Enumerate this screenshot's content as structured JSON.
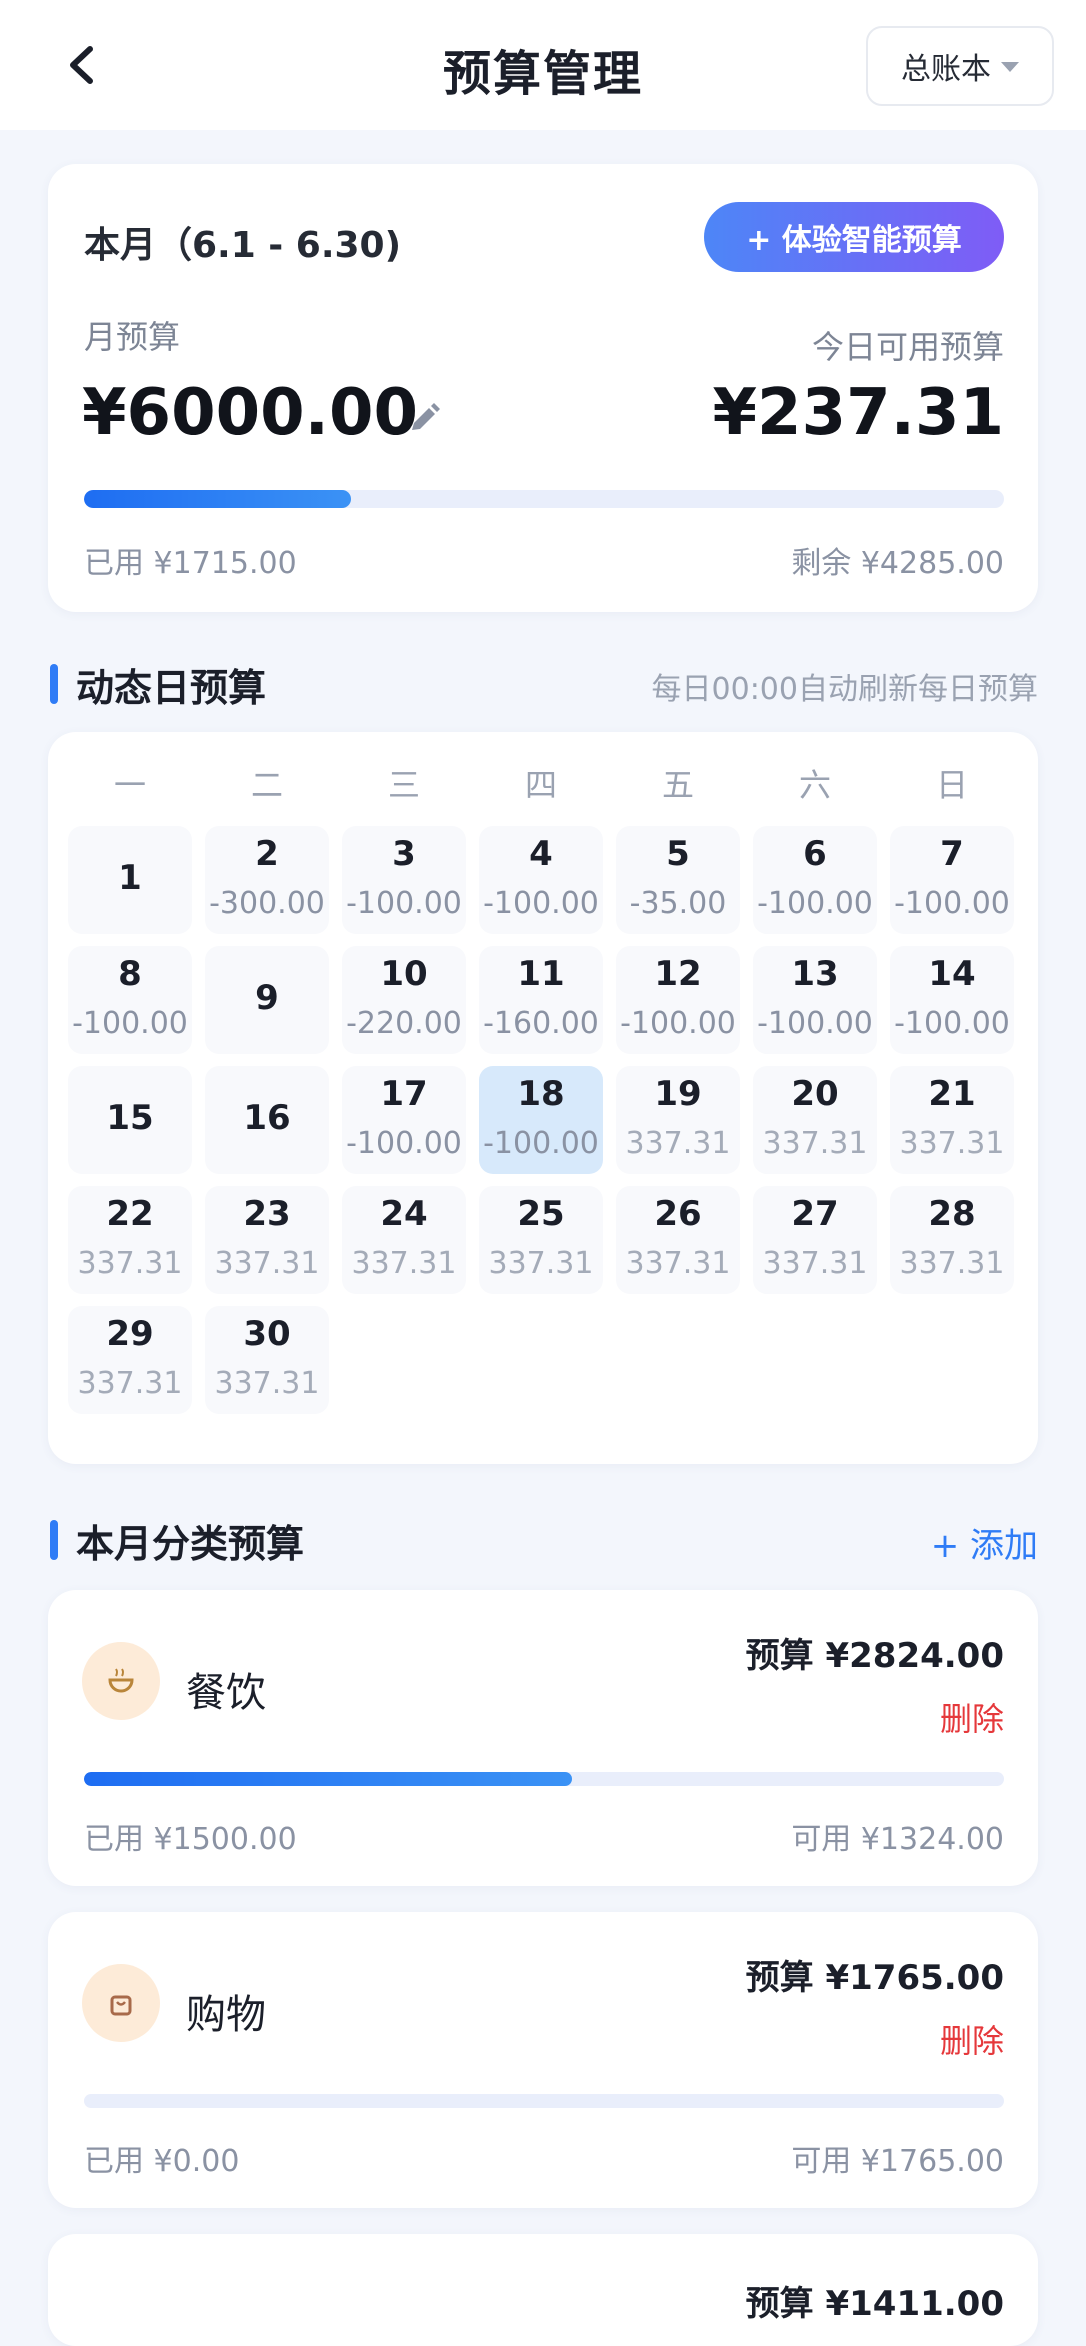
{
  "header": {
    "title": "预算管理",
    "ledger": "总账本"
  },
  "summary": {
    "period": "本月（6.1 - 6.30)",
    "smart_button": "+ 体验智能预算",
    "month_label": "月预算",
    "month_amount": "¥6000.00",
    "today_label": "今日可用预算",
    "today_amount": "¥237.31",
    "progress": 0.29,
    "used": "已用 ¥1715.00",
    "remaining": "剩余 ¥4285.00"
  },
  "daily": {
    "title": "动态日预算",
    "note": "每日00:00自动刷新每日预算"
  },
  "calendar": {
    "weekdays": [
      "一",
      "二",
      "三",
      "四",
      "五",
      "六",
      "日"
    ],
    "days": [
      {
        "d": "1",
        "v": ""
      },
      {
        "d": "2",
        "v": "-300.00"
      },
      {
        "d": "3",
        "v": "-100.00"
      },
      {
        "d": "4",
        "v": "-100.00"
      },
      {
        "d": "5",
        "v": "-35.00"
      },
      {
        "d": "6",
        "v": "-100.00"
      },
      {
        "d": "7",
        "v": "-100.00"
      },
      {
        "d": "8",
        "v": "-100.00"
      },
      {
        "d": "9",
        "v": ""
      },
      {
        "d": "10",
        "v": "-220.00"
      },
      {
        "d": "11",
        "v": "-160.00"
      },
      {
        "d": "12",
        "v": "-100.00"
      },
      {
        "d": "13",
        "v": "-100.00"
      },
      {
        "d": "14",
        "v": "-100.00"
      },
      {
        "d": "15",
        "v": ""
      },
      {
        "d": "16",
        "v": ""
      },
      {
        "d": "17",
        "v": "-100.00"
      },
      {
        "d": "18",
        "v": "-100.00",
        "today": true
      },
      {
        "d": "19",
        "v": "337.31"
      },
      {
        "d": "20",
        "v": "337.31"
      },
      {
        "d": "21",
        "v": "337.31"
      },
      {
        "d": "22",
        "v": "337.31"
      },
      {
        "d": "23",
        "v": "337.31"
      },
      {
        "d": "24",
        "v": "337.31"
      },
      {
        "d": "25",
        "v": "337.31"
      },
      {
        "d": "26",
        "v": "337.31"
      },
      {
        "d": "27",
        "v": "337.31"
      },
      {
        "d": "28",
        "v": "337.31"
      },
      {
        "d": "29",
        "v": "337.31"
      },
      {
        "d": "30",
        "v": "337.31"
      }
    ]
  },
  "categories_section": {
    "title": "本月分类预算",
    "add": "+ 添加"
  },
  "categories": [
    {
      "name": "餐饮",
      "icon": "food-bowl-icon",
      "budget": "预算 ¥2824.00",
      "delete": "删除",
      "progress": 0.53,
      "used": "已用 ¥1500.00",
      "available": "可用 ¥1324.00"
    },
    {
      "name": "购物",
      "icon": "shopping-bag-icon",
      "budget": "预算 ¥1765.00",
      "delete": "删除",
      "progress": 0.0,
      "used": "已用 ¥0.00",
      "available": "可用 ¥1765.00"
    },
    {
      "name": "",
      "icon": "",
      "budget": "预算 ¥1411.00",
      "delete": "",
      "progress": 0,
      "used": "",
      "available": ""
    }
  ],
  "colors": {
    "accent": "#2f7cf6",
    "danger": "#e5383b",
    "today_cell": "#d7e9fb"
  }
}
